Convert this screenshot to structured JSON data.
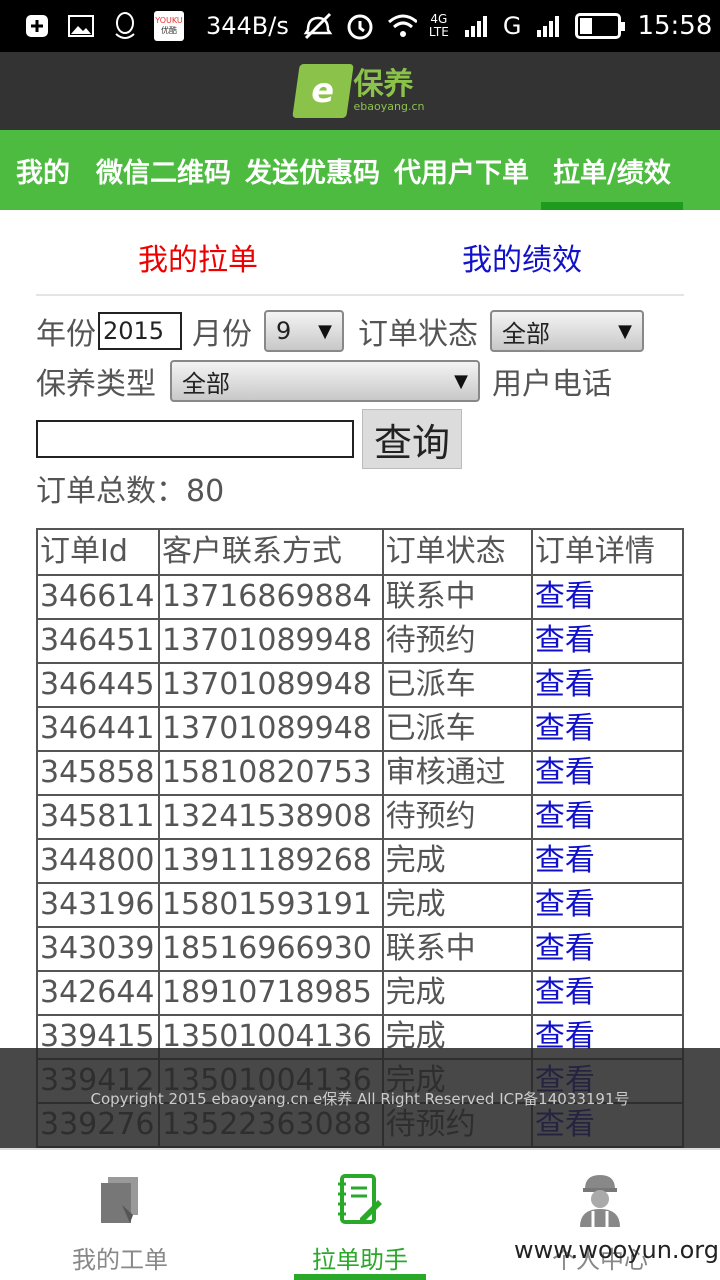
{
  "status_bar": {
    "youku_top": "YOUKU",
    "youku_bottom": "优酷",
    "speed": "344B/s",
    "net_type_top": "4G",
    "net_type_bottom": "LTE",
    "carrier": "G",
    "time": "15:58"
  },
  "header": {
    "logo_mark": "e",
    "logo_cn": "保养",
    "logo_en": "ebaoyang.cn"
  },
  "nav": {
    "items": [
      "我的",
      "微信二维码",
      "发送优惠码",
      "代用户下单",
      "拉单/绩效"
    ],
    "active_index": 4
  },
  "subtabs": {
    "my_orders": "我的拉单",
    "my_performance": "我的绩效"
  },
  "filters": {
    "year_label": "年份",
    "year_value": "2015",
    "month_label": "月份",
    "month_value": "9",
    "status_label": "订单状态",
    "status_value": "全部",
    "type_label": "保养类型",
    "type_value": "全部",
    "phone_label": "用户电话",
    "phone_value": "",
    "query_button": "查询"
  },
  "total": "订单总数：80",
  "table": {
    "headers": [
      "订单Id",
      "客户联系方式",
      "订单状态",
      "订单详情"
    ],
    "rows": [
      [
        "346614",
        "13716869884",
        "联系中",
        "查看"
      ],
      [
        "346451",
        "13701089948",
        "待预约",
        "查看"
      ],
      [
        "346445",
        "13701089948",
        "已派车",
        "查看"
      ],
      [
        "346441",
        "13701089948",
        "已派车",
        "查看"
      ],
      [
        "345858",
        "15810820753",
        "审核通过",
        "查看"
      ],
      [
        "345811",
        "13241538908",
        "待预约",
        "查看"
      ],
      [
        "344800",
        "13911189268",
        "完成",
        "查看"
      ],
      [
        "343196",
        "15801593191",
        "完成",
        "查看"
      ],
      [
        "343039",
        "18516966930",
        "联系中",
        "查看"
      ],
      [
        "342644",
        "18910718985",
        "完成",
        "查看"
      ],
      [
        "339415",
        "13501004136",
        "完成",
        "查看"
      ],
      [
        "339412",
        "13501004136",
        "完成",
        "查看"
      ],
      [
        "339276",
        "13522363088",
        "待预约",
        "查看"
      ]
    ]
  },
  "copyright": "Copyright 2015 ebaoyang.cn e保养 All Right Reserved ICP备14033191号",
  "tabbar": {
    "items": [
      {
        "label": "我的工单",
        "icon": "document-icon"
      },
      {
        "label": "拉单助手",
        "icon": "notebook-pen-icon"
      },
      {
        "label": "个人中心",
        "icon": "mechanic-icon"
      }
    ],
    "active_index": 1
  },
  "watermark": "www.wooyun.org",
  "colors": {
    "nav_green": "#4cbb3f",
    "active_green": "#2aa82a",
    "header_dark": "#333333",
    "link_blue": "#1111cc",
    "red_tab": "#ee0000"
  }
}
